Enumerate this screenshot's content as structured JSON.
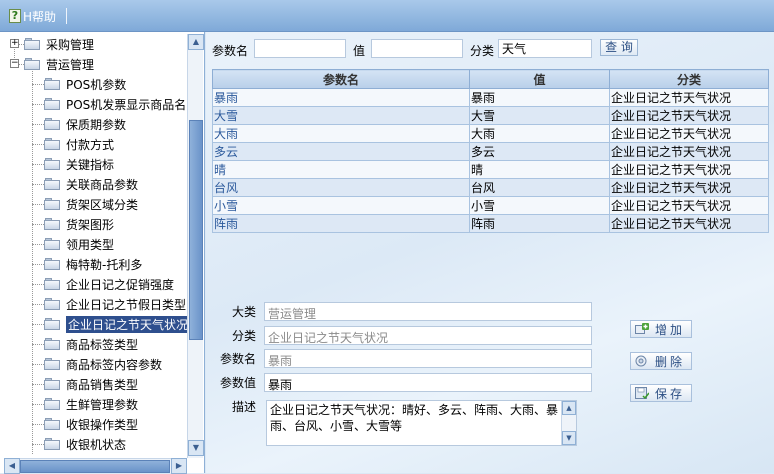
{
  "toolbar": {
    "help_label": "H帮助",
    "help_icon_glyph": "?"
  },
  "tree": {
    "parents": [
      {
        "label": "采购管理",
        "toggle": "+"
      },
      {
        "label": "营运管理",
        "toggle": "−"
      }
    ],
    "children": [
      "POS机参数",
      "POS机发票显示商品名",
      "保质期参数",
      "付款方式",
      "关键指标",
      "关联商品参数",
      "货架区域分类",
      "货架图形",
      "领用类型",
      "梅特勒-托利多",
      "企业日记之促销强度",
      "企业日记之节假日类型",
      "企业日记之节天气状况",
      "商品标签类型",
      "商品标签内容参数",
      "商品销售类型",
      "生鲜管理参数",
      "收银操作类型",
      "收银机状态"
    ],
    "selected_index": 12
  },
  "filter": {
    "param_name_label": "参数名",
    "param_name_value": "",
    "value_label": "值",
    "value_value": "",
    "category_label": "分类",
    "category_value": "天气",
    "query_button": "查 询"
  },
  "grid": {
    "columns": [
      "参数名",
      "值",
      "分类"
    ],
    "rows": [
      [
        "暴雨",
        "暴雨",
        "企业日记之节天气状况"
      ],
      [
        "大雪",
        "大雪",
        "企业日记之节天气状况"
      ],
      [
        "大雨",
        "大雨",
        "企业日记之节天气状况"
      ],
      [
        "多云",
        "多云",
        "企业日记之节天气状况"
      ],
      [
        "晴",
        "晴",
        "企业日记之节天气状况"
      ],
      [
        "台风",
        "台风",
        "企业日记之节天气状况"
      ],
      [
        "小雪",
        "小雪",
        "企业日记之节天气状况"
      ],
      [
        "阵雨",
        "阵雨",
        "企业日记之节天气状况"
      ]
    ]
  },
  "form": {
    "major_label": "大类",
    "major_value": "营运管理",
    "category_label": "分类",
    "category_value": "企业日记之节天气状况",
    "param_name_label": "参数名",
    "param_name_value": "暴雨",
    "param_value_label": "参数值",
    "param_value_value": "暴雨",
    "desc_label": "描述",
    "desc_value": "企业日记之节天气状况：晴好、多云、阵雨、大雨、暴雨、台风、小雪、大雪等"
  },
  "actions": {
    "add": "增加",
    "delete": "删除",
    "save": "保存"
  },
  "colors": {
    "accent": "#2e4f8e",
    "header_bar": "#7fa9d8",
    "link_text": "#2c5a9c"
  }
}
